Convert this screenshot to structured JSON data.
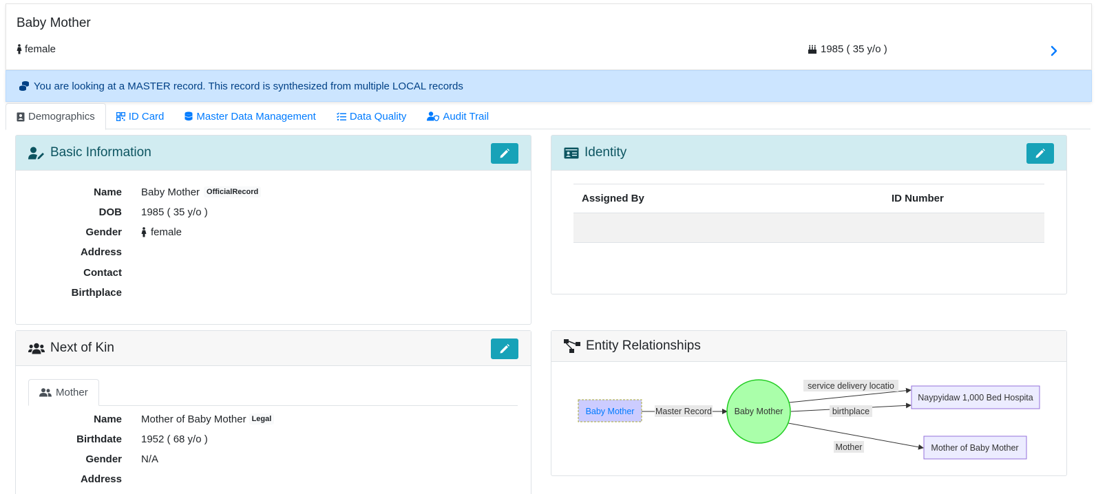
{
  "patient": {
    "name": "Baby Mother",
    "gender": "female",
    "dob": "1985 ( 35 y/o )"
  },
  "alert": {
    "text": "You are looking at a MASTER record. This record is synthesized from multiple LOCAL records"
  },
  "tabs": [
    {
      "label": "Demographics",
      "icon": "address-book-icon",
      "active": true
    },
    {
      "label": "ID Card",
      "icon": "qrcode-icon",
      "active": false
    },
    {
      "label": "Master Data Management",
      "icon": "database-icon",
      "active": false
    },
    {
      "label": "Data Quality",
      "icon": "checklist-icon",
      "active": false
    },
    {
      "label": "Audit Trail",
      "icon": "user-shield-icon",
      "active": false
    }
  ],
  "basic_info": {
    "title": "Basic Information",
    "name_label": "Name",
    "name_value": "Baby Mother",
    "name_badge": "OfficialRecord",
    "dob_label": "DOB",
    "dob_value": "1985 ( 35 y/o )",
    "gender_label": "Gender",
    "gender_value": "female",
    "address_label": "Address",
    "contact_label": "Contact",
    "birthplace_label": "Birthplace"
  },
  "identity": {
    "title": "Identity",
    "col_assigned_by": "Assigned By",
    "col_id_number": "ID Number"
  },
  "next_of_kin": {
    "title": "Next of Kin",
    "tab_label": "Mother",
    "name_label": "Name",
    "name_value": "Mother of Baby Mother",
    "name_badge": "Legal",
    "birthdate_label": "Birthdate",
    "birthdate_value": "1952 ( 68 y/o )",
    "gender_label": "Gender",
    "gender_value": "N/A",
    "address_label": "Address"
  },
  "entity_relationships": {
    "title": "Entity Relationships",
    "source_node": "Baby Mother",
    "center_node": "Baby Mother",
    "hospital_node": "Naypyidaw 1,000 Bed Hospita",
    "mother_node": "Mother of Baby Mother",
    "edge_master": "Master Record",
    "edge_service": "service delivery locatio",
    "edge_birthplace": "birthplace",
    "edge_mother": "Mother"
  },
  "colors": {
    "link": "#007bff",
    "info_bg": "#d1ecf1",
    "info_text": "#0c5460",
    "alert_bg": "#cce5ff",
    "button": "#17a2b8",
    "node_center": "#aaffaa",
    "node_center_border": "#22cc22",
    "node_box": "#ececff",
    "node_box_border": "#9370db"
  }
}
